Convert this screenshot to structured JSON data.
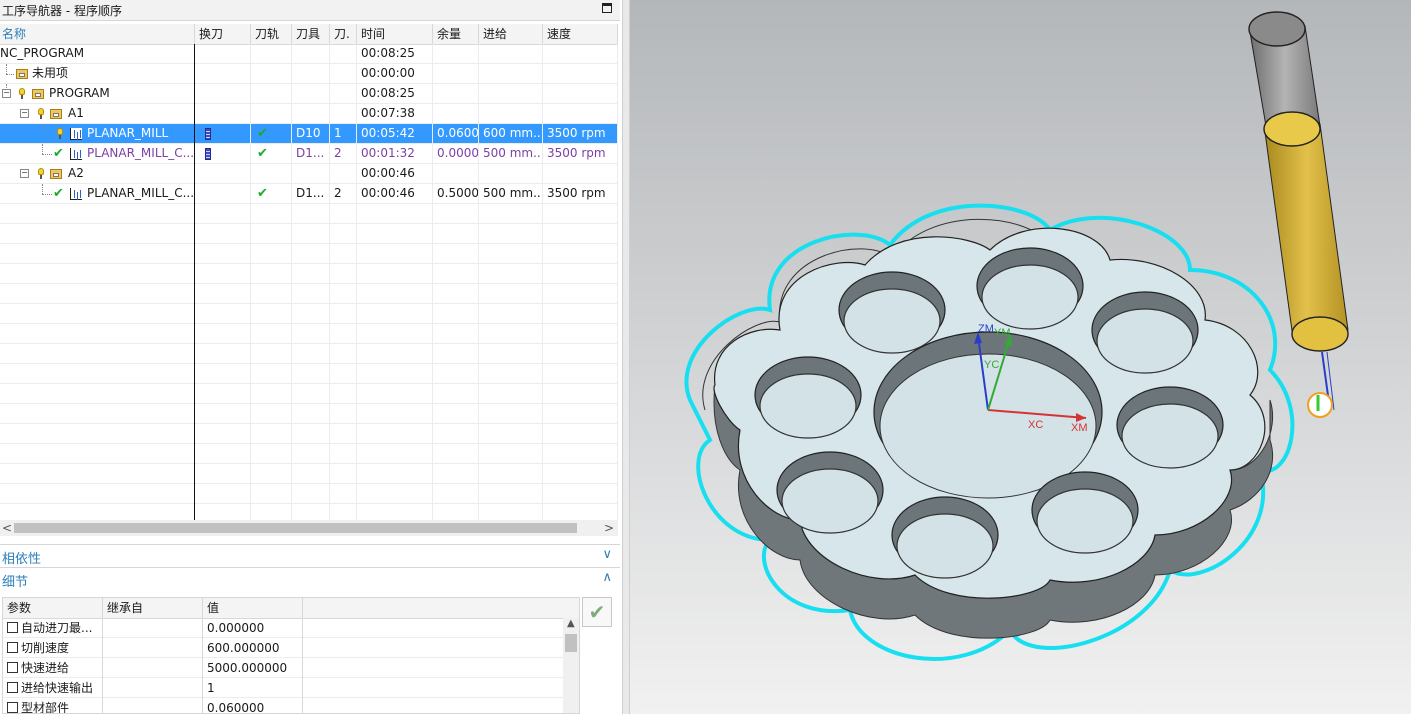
{
  "navigator": {
    "title": "工序导航器 - 程序顺序"
  },
  "columns": [
    "名称",
    "换刀",
    "刀轨",
    "刀具",
    "刀.",
    "时间",
    "余量",
    "进给",
    "速度"
  ],
  "rows": [
    {
      "name": "NC_PROGRAM",
      "tool": "",
      "toolno": "",
      "time": "00:08:25",
      "stock": "",
      "feed": "",
      "speed": ""
    },
    {
      "name": "未用项",
      "tool": "",
      "toolno": "",
      "time": "00:00:00",
      "stock": "",
      "feed": "",
      "speed": ""
    },
    {
      "name": "PROGRAM",
      "tool": "",
      "toolno": "",
      "time": "00:08:25",
      "stock": "",
      "feed": "",
      "speed": ""
    },
    {
      "name": "A1",
      "tool": "",
      "toolno": "",
      "time": "00:07:38",
      "stock": "",
      "feed": "",
      "speed": ""
    },
    {
      "name": "PLANAR_MILL",
      "tool": "D10",
      "toolno": "1",
      "time": "00:05:42",
      "stock": "0.0600",
      "feed": "600 mm...",
      "speed": "3500 rpm"
    },
    {
      "name": "PLANAR_MILL_C...",
      "tool": "D1...",
      "toolno": "2",
      "time": "00:01:32",
      "stock": "0.0000",
      "feed": "500 mm...",
      "speed": "3500 rpm"
    },
    {
      "name": "A2",
      "tool": "",
      "toolno": "",
      "time": "00:00:46",
      "stock": "",
      "feed": "",
      "speed": ""
    },
    {
      "name": "PLANAR_MILL_C...",
      "tool": "D1...",
      "toolno": "2",
      "time": "00:00:46",
      "stock": "0.5000",
      "feed": "500 mm...",
      "speed": "3500 rpm"
    }
  ],
  "panels": {
    "dependencies": "相依性",
    "details": "细节"
  },
  "param_columns": [
    "参数",
    "继承自",
    "值"
  ],
  "params": [
    {
      "name": "自动进刀最...",
      "value": "0.000000"
    },
    {
      "name": "切削速度",
      "value": "600.000000"
    },
    {
      "name": "快速进给",
      "value": "5000.000000"
    },
    {
      "name": "进给快速输出",
      "value": "1"
    },
    {
      "name": "型材部件",
      "value": "0.060000"
    }
  ],
  "axes": {
    "zm": "ZM",
    "ym": "YM",
    "yc": "YC",
    "xc": "XC",
    "xm": "XM"
  },
  "colors": {
    "selection": "#3399ff",
    "accent": "#2c7fb8",
    "part": "#d6e6ea",
    "toolpath": "#18dff0",
    "tool": "#c9a632"
  }
}
